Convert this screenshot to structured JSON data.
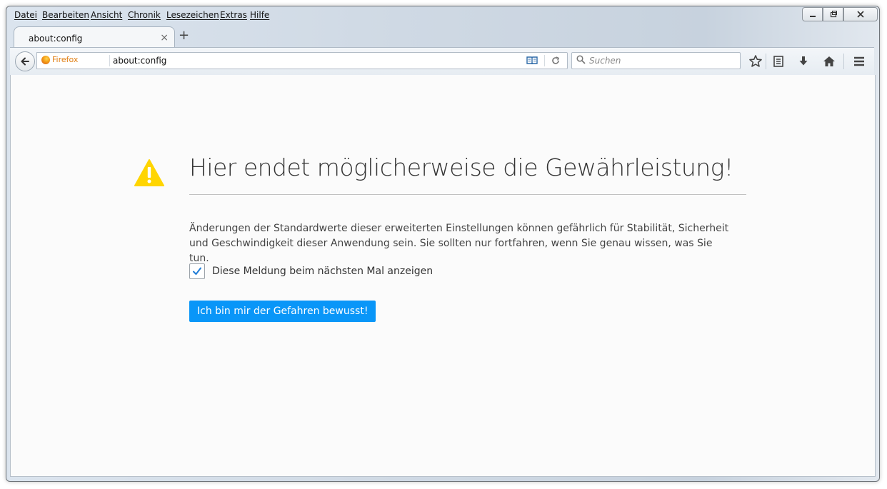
{
  "menubar": {
    "items": [
      {
        "label": "Datei"
      },
      {
        "label": "Bearbeiten"
      },
      {
        "label": "Ansicht"
      },
      {
        "label": "Chronik"
      },
      {
        "label": "Lesezeichen"
      },
      {
        "label": "Extras"
      },
      {
        "label": "Hilfe"
      }
    ]
  },
  "tabs": [
    {
      "title": "about:config",
      "close": "×"
    }
  ],
  "newtab": "+",
  "navbar": {
    "identity_label": "Firefox",
    "url": "about:config",
    "search_placeholder": "Suchen"
  },
  "content": {
    "title": "Hier endet möglicherweise die Gewährleistung!",
    "description": "Änderungen der Standardwerte dieser erweiterten Einstellungen können gefährlich für Stabilität, Sicherheit und Geschwindigkeit dieser Anwendung sein. Sie sollten nur fortfahren, wenn Sie genau wissen, was Sie tun.",
    "checkbox_label": "Diese Meldung beim nächsten Mal anzeigen",
    "checkbox_checked": true,
    "button_label": "Ich bin mir der Gefahren bewusst!"
  },
  "colors": {
    "accent": "#0996f8",
    "warning": "#ffd500"
  },
  "icons": [
    "back-arrow-icon",
    "firefox-logo-icon",
    "reader-view-icon",
    "reload-icon",
    "search-icon",
    "bookmark-star-icon",
    "bookmarks-list-icon",
    "download-icon",
    "home-icon",
    "hamburger-menu-icon",
    "warning-icon"
  ]
}
